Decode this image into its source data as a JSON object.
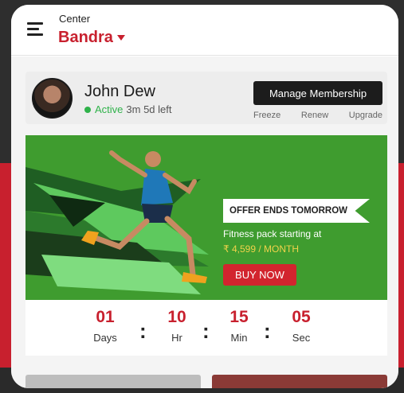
{
  "header": {
    "center_label": "Center",
    "center_value": "Bandra"
  },
  "member": {
    "name": "John Dew",
    "status_active": "Active",
    "status_remaining": "3m 5d left",
    "manage_label": "Manage Membership",
    "links": [
      "Freeze",
      "Renew",
      "Upgrade"
    ]
  },
  "banner": {
    "offer_tag": "OFFER ENDS TOMORROW",
    "line1": "Fitness pack starting at",
    "line2": "₹ 4,599 / MONTH",
    "buy_label": "BUY NOW"
  },
  "countdown": [
    {
      "value": "01",
      "label": "Days"
    },
    {
      "value": "10",
      "label": "Hr"
    },
    {
      "value": "15",
      "label": "Min"
    },
    {
      "value": "05",
      "label": "Sec"
    }
  ],
  "colors": {
    "brand_red": "#c8202e",
    "active_green": "#2fb24a",
    "banner_green": "#3f9c2f"
  },
  "icons": [
    "hamburger-menu-icon",
    "caret-down-icon",
    "status-dot-icon"
  ]
}
